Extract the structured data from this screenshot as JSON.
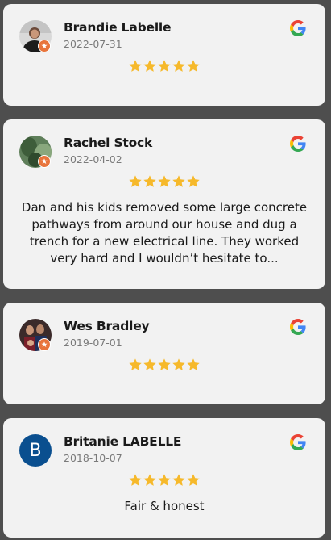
{
  "colors": {
    "page_background": "#4e4e4e",
    "card_background": "#f2f2f2",
    "star": "#f6b92b",
    "local_guide_badge": "#e8743b",
    "initial_avatar": "#0a4f8f"
  },
  "reviews": [
    {
      "name": "Brandie Labelle",
      "date": "2022-07-31",
      "rating": 5,
      "text": "",
      "avatar": "photo",
      "local_guide": true,
      "source_icon": "google-icon"
    },
    {
      "name": "Rachel Stock",
      "date": "2022-04-02",
      "rating": 5,
      "text": "Dan and his kids removed some large concrete pathways from around our house and dug a trench for a new electrical line. They worked very hard and I wouldn’t hesitate to...",
      "avatar": "photo",
      "local_guide": true,
      "source_icon": "google-icon"
    },
    {
      "name": "Wes Bradley",
      "date": "2019-07-01",
      "rating": 5,
      "text": "",
      "avatar": "photo",
      "local_guide": true,
      "source_icon": "google-icon"
    },
    {
      "name": "Britanie LABELLE",
      "date": "2018-10-07",
      "rating": 5,
      "text": "Fair & honest",
      "avatar": "initial",
      "avatar_initial": "B",
      "local_guide": false,
      "source_icon": "google-icon"
    }
  ]
}
